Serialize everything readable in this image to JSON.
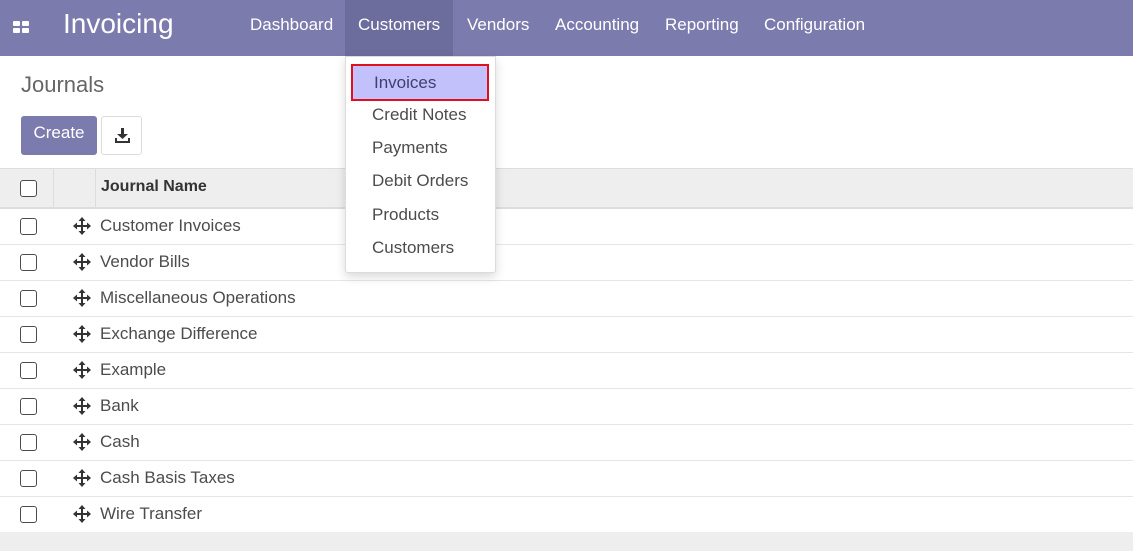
{
  "navbar": {
    "app_title": "Invoicing",
    "menu": [
      {
        "label": "Dashboard"
      },
      {
        "label": "Customers"
      },
      {
        "label": "Vendors"
      },
      {
        "label": "Accounting"
      },
      {
        "label": "Reporting"
      },
      {
        "label": "Configuration"
      }
    ],
    "active_menu": "Customers",
    "color": "#7c7bad"
  },
  "dropdown": {
    "items": [
      {
        "label": "Invoices"
      },
      {
        "label": "Credit Notes"
      },
      {
        "label": "Payments"
      },
      {
        "label": "Debit Orders"
      },
      {
        "label": "Products"
      },
      {
        "label": "Customers"
      }
    ],
    "highlighted": "Invoices",
    "highlight_color": "#c2c1fb",
    "highlight_border": "#e0101f"
  },
  "page": {
    "title": "Journals",
    "create_label": "Create",
    "download_icon": "download-icon"
  },
  "table": {
    "column_header": "Journal Name",
    "rows": [
      {
        "name": "Customer Invoices"
      },
      {
        "name": "Vendor Bills"
      },
      {
        "name": "Miscellaneous Operations"
      },
      {
        "name": "Exchange Difference"
      },
      {
        "name": "Example"
      },
      {
        "name": "Bank"
      },
      {
        "name": "Cash"
      },
      {
        "name": "Cash Basis Taxes"
      },
      {
        "name": "Wire Transfer"
      }
    ],
    "row_handle_icon": "move-handle-icon"
  }
}
